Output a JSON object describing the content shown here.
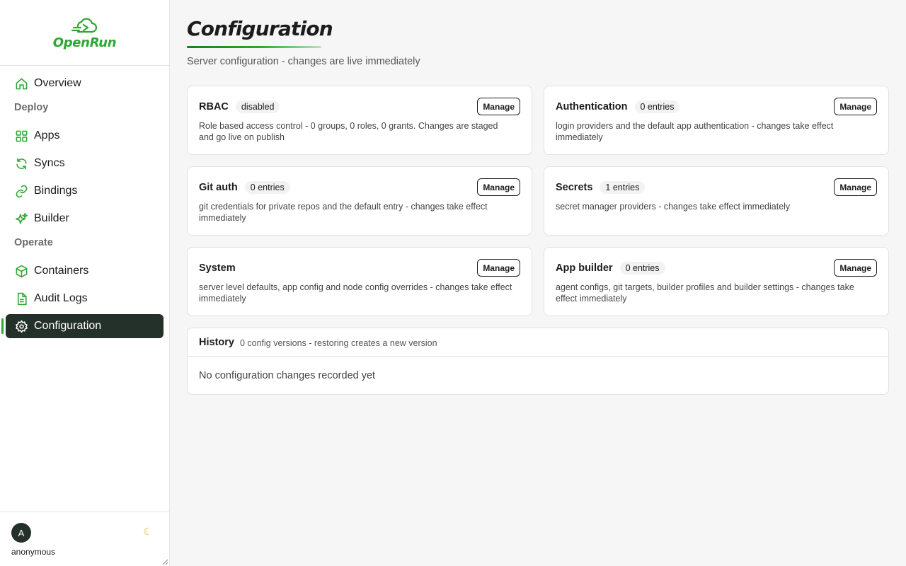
{
  "brand": {
    "name": "OpenRun",
    "color": "#2da832"
  },
  "sidebar": {
    "items_top": [
      {
        "label": "Overview",
        "icon": "home-icon"
      }
    ],
    "sections": [
      {
        "label": "Deploy",
        "items": [
          {
            "label": "Apps",
            "icon": "grid-icon"
          },
          {
            "label": "Syncs",
            "icon": "refresh-icon"
          },
          {
            "label": "Bindings",
            "icon": "link-icon"
          },
          {
            "label": "Builder",
            "icon": "sparkles-icon"
          }
        ]
      },
      {
        "label": "Operate",
        "items": [
          {
            "label": "Containers",
            "icon": "box-icon"
          },
          {
            "label": "Audit Logs",
            "icon": "file-text-icon"
          },
          {
            "label": "Configuration",
            "icon": "gear-icon",
            "active": true
          }
        ]
      }
    ],
    "user": {
      "initial": "A",
      "name": "anonymous",
      "theme_icon": "moon-icon"
    }
  },
  "page": {
    "title": "Configuration",
    "subtitle": "Server configuration - changes are live immediately"
  },
  "cards": [
    {
      "title": "RBAC",
      "badge": "disabled",
      "button": "Manage",
      "description": "Role based access control - 0 groups, 0 roles, 0 grants. Changes are staged and go live on publish"
    },
    {
      "title": "Authentication",
      "badge": "0 entries",
      "button": "Manage",
      "description": "login providers and the default app authentication - changes take effect immediately"
    },
    {
      "title": "Git auth",
      "badge": "0 entries",
      "button": "Manage",
      "description": "git credentials for private repos and the default entry - changes take effect immediately"
    },
    {
      "title": "Secrets",
      "badge": "1 entries",
      "button": "Manage",
      "description": "secret manager providers - changes take effect immediately"
    },
    {
      "title": "System",
      "badge": "",
      "button": "Manage",
      "description": "server level defaults, app config and node config overrides - changes take effect immediately"
    },
    {
      "title": "App builder",
      "badge": "0 entries",
      "button": "Manage",
      "description": "agent configs, git targets, builder profiles and builder settings - changes take effect immediately"
    }
  ],
  "history": {
    "title": "History",
    "subtitle": "0 config versions - restoring creates a new version",
    "empty_message": "No configuration changes recorded yet"
  }
}
